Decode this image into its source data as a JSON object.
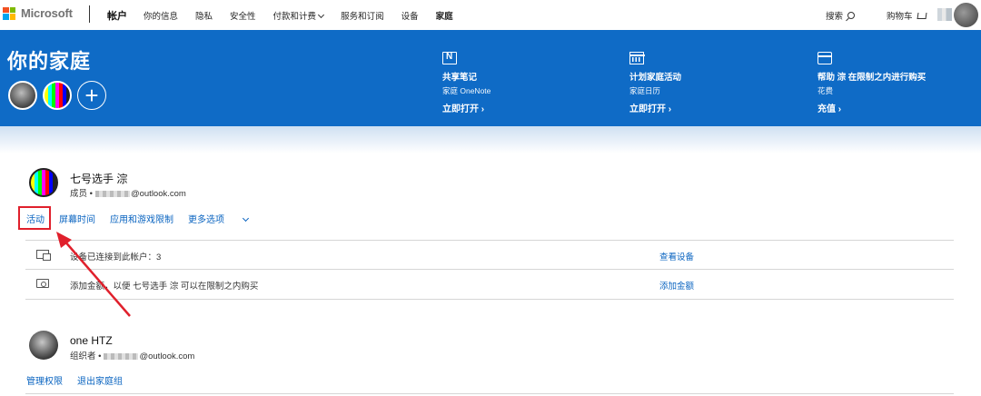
{
  "topnav": {
    "logo_text": "Microsoft",
    "brand": "帐户",
    "items": [
      "你的信息",
      "隐私",
      "安全性",
      "付款和计费",
      "服务和订阅",
      "设备",
      "家庭"
    ],
    "search_label": "搜索",
    "cart_label": "购物车"
  },
  "hero": {
    "title": "你的家庭",
    "add_symbol": "+",
    "features": [
      {
        "title": "共享笔记",
        "subtitle": "家庭 OneNote",
        "link": "立即打开 ›"
      },
      {
        "title": "计划家庭活动",
        "subtitle": "家庭日历",
        "link": "立即打开 ›"
      },
      {
        "title": "帮助 淙 在限制之内进行购买",
        "subtitle": "花费",
        "link": "充值 ›"
      }
    ]
  },
  "members": [
    {
      "name": "七号选手 淙",
      "role": "成员 •",
      "email_suffix": "@outlook.com",
      "links": [
        "活动",
        "屏幕时间",
        "应用和游戏限制",
        "更多选项"
      ],
      "rows": [
        {
          "text": "设备已连接到此帐户：3",
          "link": "查看设备"
        },
        {
          "text": "添加金额，以便 七号选手 淙 可以在限制之内购买",
          "link": "添加金额"
        }
      ]
    },
    {
      "name": "one HTZ",
      "role": "组织者 •",
      "email_suffix": "@outlook.com",
      "links": [
        "管理权限",
        "退出家庭组"
      ]
    }
  ],
  "colors": {
    "hero_blue": "#0f6bc6",
    "link_blue": "#0a64c0",
    "highlight_red": "#e0202c",
    "ms_red": "#f25022",
    "ms_green": "#7fba00",
    "ms_blue": "#00a4ef",
    "ms_yellow": "#ffb900"
  }
}
